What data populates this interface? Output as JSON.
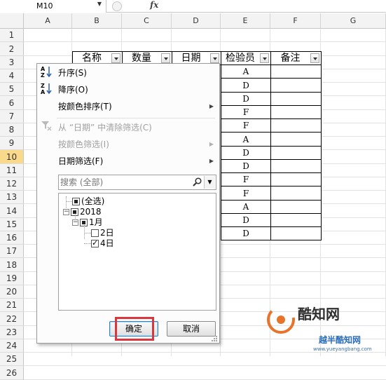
{
  "formula_bar": {
    "name_box": "M10",
    "fx_label": "fx"
  },
  "columns": [
    "A",
    "B",
    "C",
    "D",
    "E",
    "F",
    "G"
  ],
  "rows": [
    "1",
    "2",
    "3",
    "4",
    "5",
    "6",
    "7",
    "8",
    "9",
    "10",
    "11",
    "12",
    "13",
    "14",
    "15",
    "16",
    "17",
    "18",
    "19",
    "20",
    "21",
    "22",
    "23",
    "24",
    "25",
    "26"
  ],
  "active_row": "10",
  "table": {
    "headers": [
      "名称",
      "数量",
      "日期",
      "检验员",
      "备注"
    ],
    "inspectors": [
      "A",
      "D",
      "D",
      "F",
      "F",
      "A",
      "D",
      "D",
      "F",
      "F",
      "A",
      "D",
      "D"
    ]
  },
  "filter_menu": {
    "sort_asc": {
      "icon": "A↓Z",
      "label": "升序(S)"
    },
    "sort_desc": {
      "icon": "Z↓A",
      "label": "降序(O)"
    },
    "sort_by_color": "按颜色排序(T)",
    "clear_filter": "从 “日期” 中清除筛选(C)",
    "filter_by_color": "按颜色筛选(I)",
    "date_filter": "日期筛选(F)",
    "search_placeholder": "搜索 (全部)",
    "tree": {
      "select_all": "(全选)",
      "year": "2018",
      "month": "1月",
      "day1": "2日",
      "day2": "4日"
    },
    "ok": "确定",
    "cancel": "取消"
  },
  "watermark": {
    "brand": "酷知网",
    "sub": "越半酷知网",
    "url": "www.yueyangbang.com"
  },
  "colors": {
    "active_row": "#fbd98b",
    "highlight": "#d9363e",
    "accent": "#2a6dbd"
  }
}
